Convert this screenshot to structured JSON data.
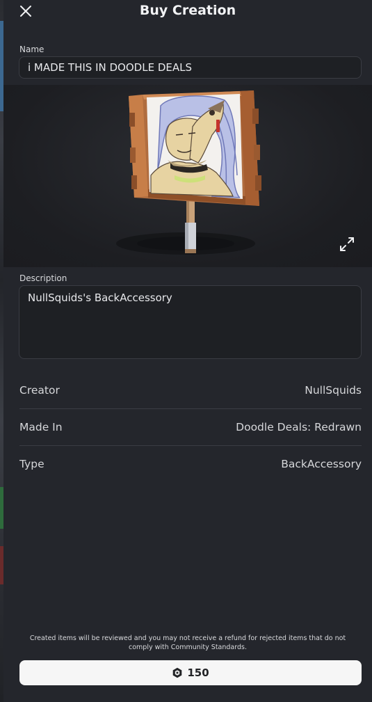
{
  "header": {
    "title": "Buy Creation"
  },
  "name": {
    "label": "Name",
    "value": "i MADE THIS IN DOODLE DEALS"
  },
  "description": {
    "label": "Description",
    "value": "NullSquids's BackAccessory"
  },
  "details": [
    {
      "key": "Creator",
      "value": "NullSquids"
    },
    {
      "key": "Made In",
      "value": "Doodle Deals: Redrawn"
    },
    {
      "key": "Type",
      "value": "BackAccessory"
    }
  ],
  "footer": {
    "disclaimer": "Created items will be reviewed and you may not receive a refund for rejected items that do not comply with Community Standards.",
    "price": "150",
    "currency_icon": "robux-icon"
  },
  "icons": {
    "close": "close-icon",
    "expand": "expand-icon"
  },
  "colors": {
    "background": "#24262c",
    "field_background": "#1e2024",
    "button_background": "#f6f6f6",
    "text": "#e8e9ec"
  }
}
